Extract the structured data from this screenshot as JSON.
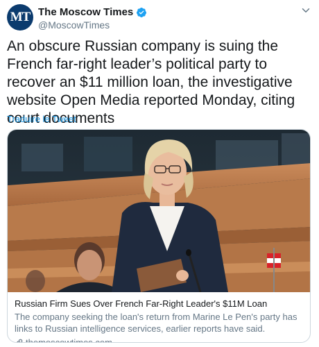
{
  "account": {
    "avatar_text": "MT",
    "display_name": "The Moscow Times",
    "handle": "@MoscowTimes"
  },
  "tweet": {
    "text": "An obscure Russian company is suing the French far-right leader’s political party to recover an $11 million loan, the investigative website Open Media reported Monday, citing court documents",
    "translate_label": "Traduire le Tweet"
  },
  "card": {
    "title": "Russian Firm Sues Over French Far-Right Leader's $11M Loan",
    "description": "The company seeking the loan's return from Marine Le Pen's party has links to Russian intelligence services, earlier reports have said.",
    "domain": "themoscowtimes.com"
  },
  "icons": {
    "verified": "verified-badge-icon",
    "caret": "chevron-down-icon",
    "link": "link-icon"
  },
  "colors": {
    "link_blue": "#1b95e0",
    "secondary_text": "#657786",
    "avatar_bg": "#0b3b6e"
  }
}
